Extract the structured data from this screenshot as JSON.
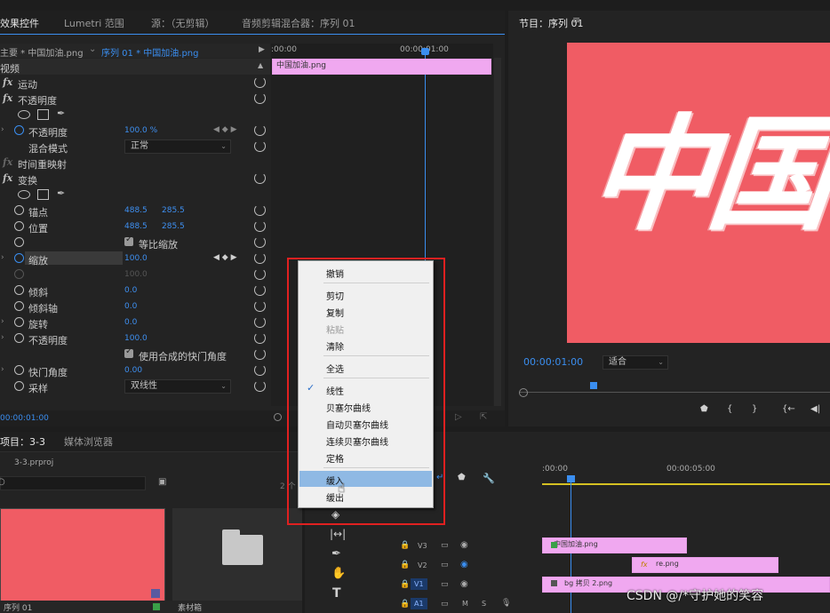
{
  "effect_controls": {
    "tabs": [
      "效果控件",
      "Lumetri 范围",
      "源：（无剪辑）",
      "音频剪辑混合器：序列 01"
    ],
    "source_master": "主要 * 中国加油.png",
    "source_seq": "序列 01 * 中国加油.png",
    "ruler_start": ":00:00",
    "ruler_mark": "00:00:01:00",
    "section_video": "视频",
    "clip_label": "中国加油.png",
    "footer_time": "00:00:01:00",
    "rows": {
      "motion": "运动",
      "opacity_group": "不透明度",
      "opacity": "不透明度",
      "opacity_val": "100.0 %",
      "blend": "混合模式",
      "blend_val": "正常",
      "time_remap": "时间重映射",
      "transform": "变换",
      "anchor": "锚点",
      "anchor_x": "488.5",
      "anchor_y": "285.5",
      "position": "位置",
      "position_x": "488.5",
      "position_y": "285.5",
      "uniform_scale": "等比缩放",
      "scale": "缩放",
      "scale_val": "100.0",
      "scale_width_val": "100.0",
      "skew": "倾斜",
      "skew_val": "0.0",
      "skew_axis": "倾斜轴",
      "skew_axis_val": "0.0",
      "rotation": "旋转",
      "rotation_val": "0.0",
      "opacity2": "不透明度",
      "opacity2_val": "100.0",
      "use_comp_shutter": "使用合成的快门角度",
      "shutter": "快门角度",
      "shutter_val": "0.00",
      "sampling": "采样",
      "sampling_val": "双线性"
    }
  },
  "program": {
    "title": "节目：序列 01",
    "timecode": "00:00:01:00",
    "fit": "适合",
    "artwork_text": "中国"
  },
  "context_menu": {
    "items": [
      "撤销",
      "剪切",
      "复制",
      "粘贴",
      "清除",
      "全选",
      "线性",
      "贝塞尔曲线",
      "自动贝塞尔曲线",
      "连续贝塞尔曲线",
      "定格",
      "缓入",
      "缓出"
    ]
  },
  "project": {
    "tabs": [
      "项目：3-3",
      "媒体浏览器"
    ],
    "file": "3-3.prproj",
    "count": "2 个",
    "thumb1": "序列 01",
    "thumb2": "素材箱"
  },
  "timeline": {
    "t0": ":00:00",
    "t5": "00:00:05:00",
    "tracks": [
      "V3",
      "V2",
      "V1",
      "A1"
    ],
    "clips": [
      "中国加油.png",
      "re.png",
      "bg 拷贝 2.png"
    ]
  },
  "watermark": "CSDN @/*守护她的笑容",
  "colors": {
    "accent": "#3a8ef0",
    "clip": "#f0a8f0",
    "canvas": "#f05c64",
    "menu_highlight": "#8fb9e4",
    "annot": "#e02020"
  }
}
